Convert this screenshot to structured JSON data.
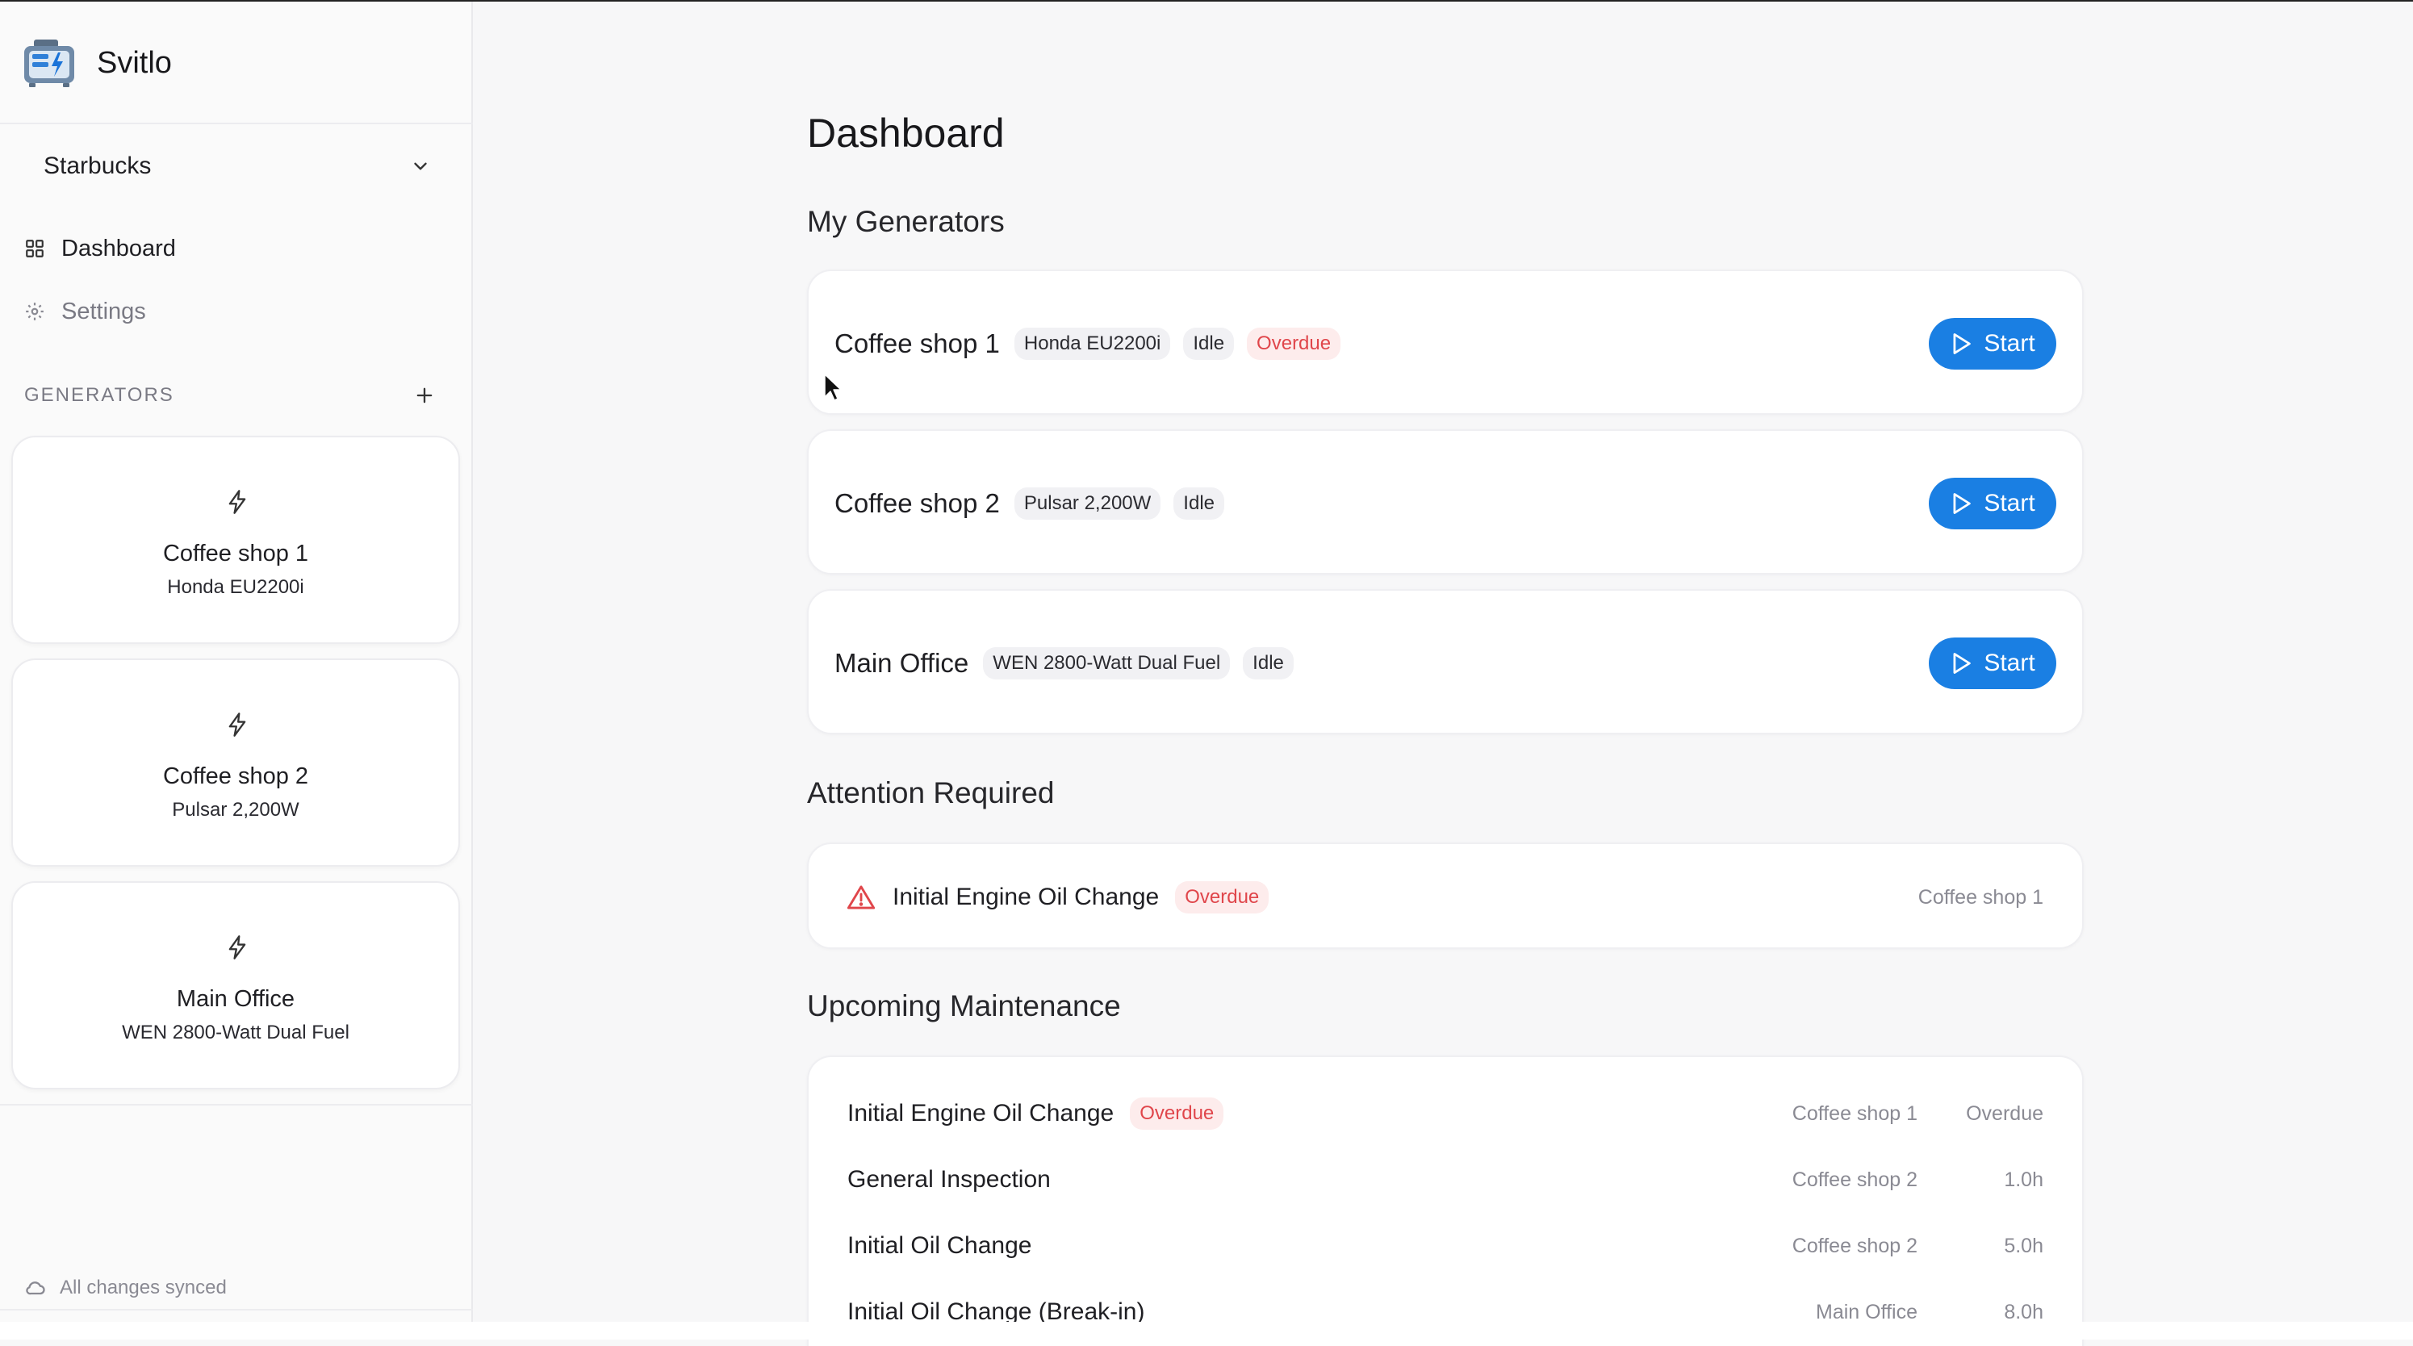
{
  "app": {
    "name": "Svitlo"
  },
  "sidebar": {
    "org_selector": {
      "label": "Starbucks"
    },
    "nav": [
      {
        "label": "Dashboard",
        "icon": "grid-icon"
      },
      {
        "label": "Settings",
        "icon": "gear-icon"
      }
    ],
    "generators_heading": "GENERATORS",
    "generators": [
      {
        "name": "Coffee shop 1",
        "model": "Honda EU2200i",
        "icon": "lightning-icon"
      },
      {
        "name": "Coffee shop 2",
        "model": "Pulsar 2,200W",
        "icon": "lightning-icon"
      },
      {
        "name": "Main Office",
        "model": "WEN 2800-Watt Dual Fuel",
        "icon": "lightning-icon"
      }
    ],
    "sync_status": "All changes synced"
  },
  "main": {
    "title": "Dashboard",
    "my_generators": {
      "heading": "My Generators",
      "items": [
        {
          "name": "Coffee shop 1",
          "model": "Honda EU2200i",
          "status": "Idle",
          "flag": "Overdue",
          "button": "Start"
        },
        {
          "name": "Coffee shop 2",
          "model": "Pulsar 2,200W",
          "status": "Idle",
          "button": "Start"
        },
        {
          "name": "Main Office",
          "model": "WEN 2800-Watt Dual Fuel",
          "status": "Idle",
          "button": "Start"
        }
      ]
    },
    "attention": {
      "heading": "Attention Required",
      "items": [
        {
          "title": "Initial Engine Oil Change",
          "flag": "Overdue",
          "generator": "Coffee shop 1",
          "icon": "warning-icon"
        }
      ]
    },
    "upcoming": {
      "heading": "Upcoming Maintenance",
      "items": [
        {
          "title": "Initial Engine Oil Change",
          "flag": "Overdue",
          "generator": "Coffee shop 1",
          "due": "Overdue"
        },
        {
          "title": "General Inspection",
          "generator": "Coffee shop 2",
          "due": "1.0h"
        },
        {
          "title": "Initial Oil Change",
          "generator": "Coffee shop 2",
          "due": "5.0h"
        },
        {
          "title": "Initial Oil Change (Break-in)",
          "generator": "Main Office",
          "due": "8.0h"
        }
      ]
    }
  },
  "colors": {
    "accent": "#1a7fe3",
    "overdue_text": "#e0464b",
    "overdue_bg": "#fdecec"
  }
}
